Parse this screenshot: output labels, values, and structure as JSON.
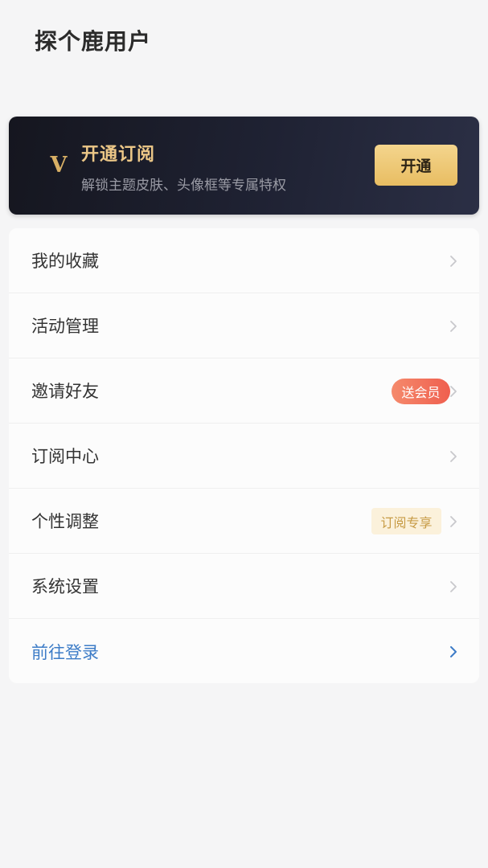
{
  "header": {
    "title": "探个鹿用户"
  },
  "vip_card": {
    "badge": "V",
    "title": "开通订阅",
    "subtitle": "解锁主题皮肤、头像框等专属特权",
    "button_label": "开通"
  },
  "menu": {
    "items": [
      {
        "label": "我的收藏"
      },
      {
        "label": "活动管理"
      },
      {
        "label": "邀请好友",
        "badge": "送会员"
      },
      {
        "label": "订阅中心"
      },
      {
        "label": "个性调整",
        "badge": "订阅专享"
      },
      {
        "label": "系统设置"
      },
      {
        "label": "前往登录"
      }
    ]
  },
  "colors": {
    "background": "#f5f5f6",
    "gold_accent": "#ecc787",
    "link_blue": "#3d7cc7",
    "badge_red": "#ef5f4f"
  },
  "icons": [
    "chevron-right-icon",
    "vip-badge-icon"
  ]
}
